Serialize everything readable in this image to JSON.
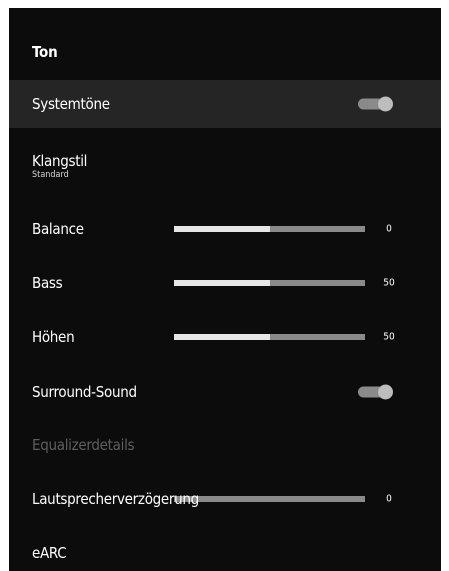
{
  "title": "Ton",
  "rows": [
    {
      "label": "Systemtöne",
      "toggle_on": true
    },
    {
      "label": "Klangstil",
      "sublabel": "Standard"
    },
    {
      "label": "Balance",
      "value": "0",
      "level": 0.5
    },
    {
      "label": "Bass",
      "value": "50",
      "level": 0.5
    },
    {
      "label": "Höhen",
      "value": "50",
      "level": 0.5
    },
    {
      "label": "Surround-Sound",
      "toggle_on": true
    },
    {
      "label": "Equalizerdetails"
    },
    {
      "label": "Lautsprecherverzögerung",
      "value": "0",
      "level": 0
    },
    {
      "label": "eARC"
    }
  ],
  "colors": {
    "panel_bg": "#0c0c0c",
    "selected_bg": "#252525",
    "slider_fill": "#e6e6e6",
    "slider_track": "#8a8a8a",
    "disabled_text": "#5e5e5e"
  }
}
